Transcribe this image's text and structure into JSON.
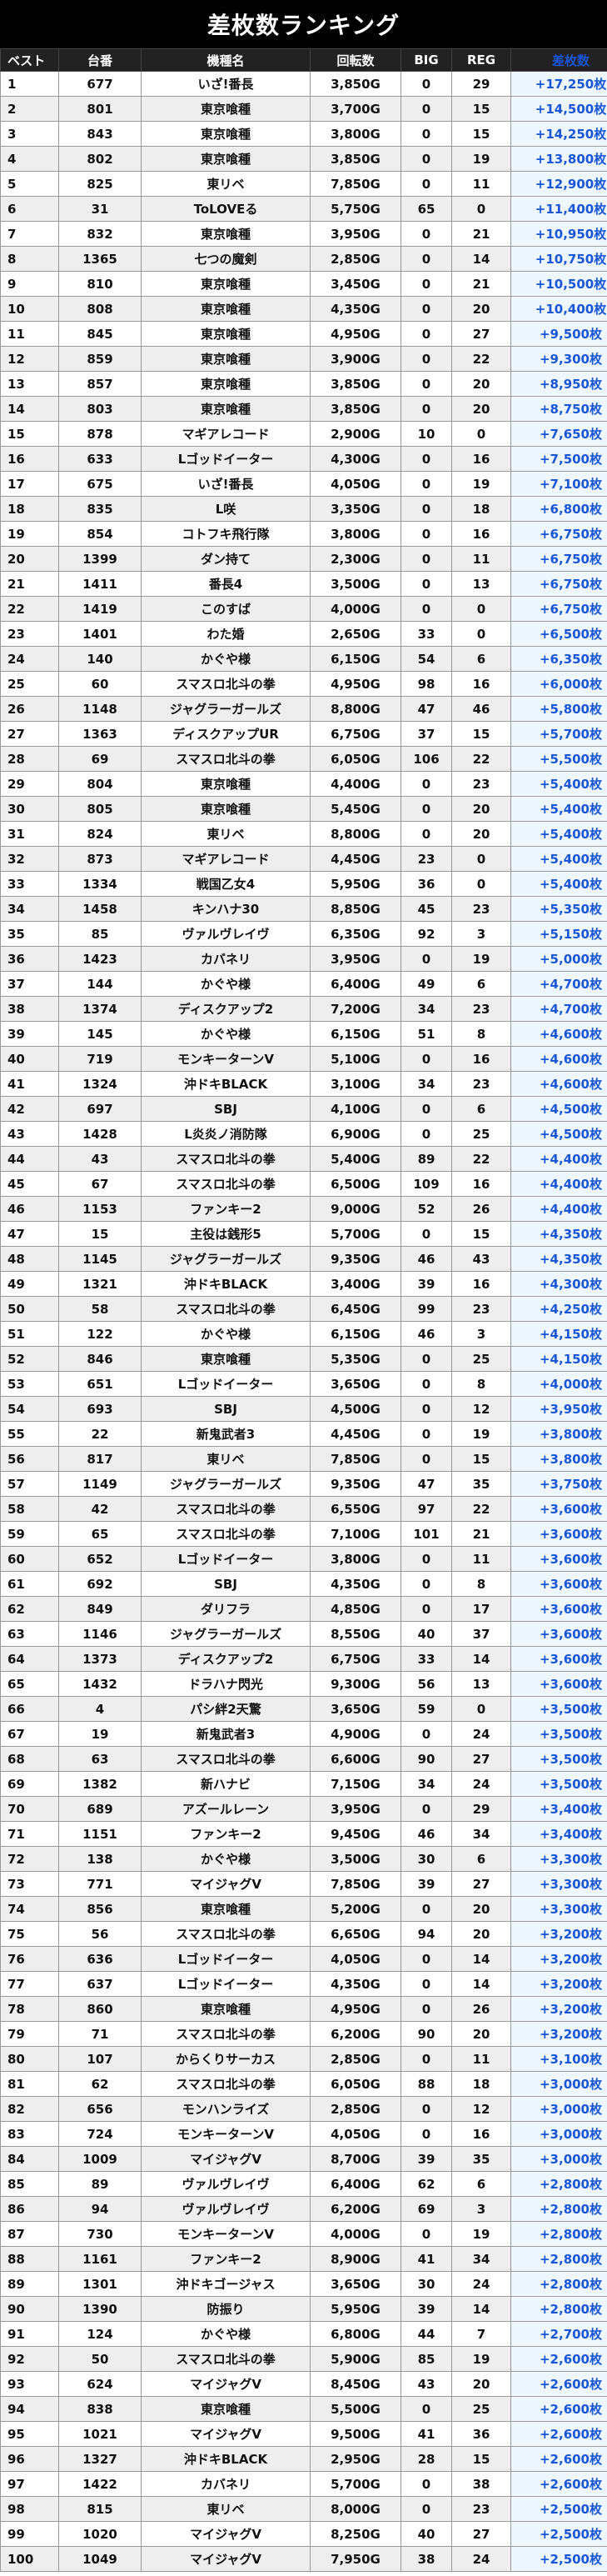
{
  "title": "差枚数ランキング",
  "columns": [
    "ベスト",
    "台番",
    "機種名",
    "回転数",
    "BIG",
    "REG",
    "差枚数"
  ],
  "rows": [
    [
      "1",
      "677",
      "いざ!番長",
      "3,850G",
      "0",
      "29",
      "+17,250枚"
    ],
    [
      "2",
      "801",
      "東京喰種",
      "3,700G",
      "0",
      "15",
      "+14,500枚"
    ],
    [
      "3",
      "843",
      "東京喰種",
      "3,800G",
      "0",
      "15",
      "+14,250枚"
    ],
    [
      "4",
      "802",
      "東京喰種",
      "3,850G",
      "0",
      "19",
      "+13,800枚"
    ],
    [
      "5",
      "825",
      "東リベ",
      "7,850G",
      "0",
      "11",
      "+12,900枚"
    ],
    [
      "6",
      "31",
      "ToLOVEる",
      "5,750G",
      "65",
      "0",
      "+11,400枚"
    ],
    [
      "7",
      "832",
      "東京喰種",
      "3,950G",
      "0",
      "21",
      "+10,950枚"
    ],
    [
      "8",
      "1365",
      "七つの魔剣",
      "2,850G",
      "0",
      "14",
      "+10,750枚"
    ],
    [
      "9",
      "810",
      "東京喰種",
      "3,450G",
      "0",
      "21",
      "+10,500枚"
    ],
    [
      "10",
      "808",
      "東京喰種",
      "4,350G",
      "0",
      "20",
      "+10,400枚"
    ],
    [
      "11",
      "845",
      "東京喰種",
      "4,950G",
      "0",
      "27",
      "+9,500枚"
    ],
    [
      "12",
      "859",
      "東京喰種",
      "3,900G",
      "0",
      "22",
      "+9,300枚"
    ],
    [
      "13",
      "857",
      "東京喰種",
      "3,850G",
      "0",
      "20",
      "+8,950枚"
    ],
    [
      "14",
      "803",
      "東京喰種",
      "3,850G",
      "0",
      "20",
      "+8,750枚"
    ],
    [
      "15",
      "878",
      "マギアレコード",
      "2,900G",
      "10",
      "0",
      "+7,650枚"
    ],
    [
      "16",
      "633",
      "Lゴッドイーター",
      "4,300G",
      "0",
      "16",
      "+7,500枚"
    ],
    [
      "17",
      "675",
      "いざ!番長",
      "4,050G",
      "0",
      "19",
      "+7,100枚"
    ],
    [
      "18",
      "835",
      "L咲",
      "3,350G",
      "0",
      "18",
      "+6,800枚"
    ],
    [
      "19",
      "854",
      "コトフキ飛行隊",
      "3,800G",
      "0",
      "16",
      "+6,750枚"
    ],
    [
      "20",
      "1399",
      "ダン持て",
      "2,300G",
      "0",
      "11",
      "+6,750枚"
    ],
    [
      "21",
      "1411",
      "番長4",
      "3,500G",
      "0",
      "13",
      "+6,750枚"
    ],
    [
      "22",
      "1419",
      "このすば",
      "4,000G",
      "0",
      "0",
      "+6,750枚"
    ],
    [
      "23",
      "1401",
      "わた婚",
      "2,650G",
      "33",
      "0",
      "+6,500枚"
    ],
    [
      "24",
      "140",
      "かぐや様",
      "6,150G",
      "54",
      "6",
      "+6,350枚"
    ],
    [
      "25",
      "60",
      "スマスロ北斗の拳",
      "4,950G",
      "98",
      "16",
      "+6,000枚"
    ],
    [
      "26",
      "1148",
      "ジャグラーガールズ",
      "8,800G",
      "47",
      "46",
      "+5,800枚"
    ],
    [
      "27",
      "1363",
      "ディスクアップUR",
      "6,750G",
      "37",
      "15",
      "+5,700枚"
    ],
    [
      "28",
      "69",
      "スマスロ北斗の拳",
      "6,050G",
      "106",
      "22",
      "+5,500枚"
    ],
    [
      "29",
      "804",
      "東京喰種",
      "4,400G",
      "0",
      "23",
      "+5,400枚"
    ],
    [
      "30",
      "805",
      "東京喰種",
      "5,450G",
      "0",
      "20",
      "+5,400枚"
    ],
    [
      "31",
      "824",
      "東リベ",
      "8,800G",
      "0",
      "20",
      "+5,400枚"
    ],
    [
      "32",
      "873",
      "マギアレコード",
      "4,450G",
      "23",
      "0",
      "+5,400枚"
    ],
    [
      "33",
      "1334",
      "戦国乙女4",
      "5,950G",
      "36",
      "0",
      "+5,400枚"
    ],
    [
      "34",
      "1458",
      "キンハナ30",
      "8,850G",
      "45",
      "23",
      "+5,350枚"
    ],
    [
      "35",
      "85",
      "ヴァルヴレイヴ",
      "6,350G",
      "92",
      "3",
      "+5,150枚"
    ],
    [
      "36",
      "1423",
      "カバネリ",
      "3,950G",
      "0",
      "19",
      "+5,000枚"
    ],
    [
      "37",
      "144",
      "かぐや様",
      "6,400G",
      "49",
      "6",
      "+4,700枚"
    ],
    [
      "38",
      "1374",
      "ディスクアップ2",
      "7,200G",
      "34",
      "23",
      "+4,700枚"
    ],
    [
      "39",
      "145",
      "かぐや様",
      "6,150G",
      "51",
      "8",
      "+4,600枚"
    ],
    [
      "40",
      "719",
      "モンキーターンV",
      "5,100G",
      "0",
      "16",
      "+4,600枚"
    ],
    [
      "41",
      "1324",
      "沖ドキBLACK",
      "3,100G",
      "34",
      "23",
      "+4,600枚"
    ],
    [
      "42",
      "697",
      "SBJ",
      "4,100G",
      "0",
      "6",
      "+4,500枚"
    ],
    [
      "43",
      "1428",
      "L炎炎ノ消防隊",
      "6,900G",
      "0",
      "25",
      "+4,500枚"
    ],
    [
      "44",
      "43",
      "スマスロ北斗の拳",
      "5,400G",
      "89",
      "22",
      "+4,400枚"
    ],
    [
      "45",
      "67",
      "スマスロ北斗の拳",
      "6,500G",
      "109",
      "16",
      "+4,400枚"
    ],
    [
      "46",
      "1153",
      "ファンキー2",
      "9,000G",
      "52",
      "26",
      "+4,400枚"
    ],
    [
      "47",
      "15",
      "主役は銭形5",
      "5,700G",
      "0",
      "15",
      "+4,350枚"
    ],
    [
      "48",
      "1145",
      "ジャグラーガールズ",
      "9,350G",
      "46",
      "43",
      "+4,350枚"
    ],
    [
      "49",
      "1321",
      "沖ドキBLACK",
      "3,400G",
      "39",
      "16",
      "+4,300枚"
    ],
    [
      "50",
      "58",
      "スマスロ北斗の拳",
      "6,450G",
      "99",
      "23",
      "+4,250枚"
    ],
    [
      "51",
      "122",
      "かぐや様",
      "6,150G",
      "46",
      "3",
      "+4,150枚"
    ],
    [
      "52",
      "846",
      "東京喰種",
      "5,350G",
      "0",
      "25",
      "+4,150枚"
    ],
    [
      "53",
      "651",
      "Lゴッドイーター",
      "3,650G",
      "0",
      "8",
      "+4,000枚"
    ],
    [
      "54",
      "693",
      "SBJ",
      "4,500G",
      "0",
      "12",
      "+3,950枚"
    ],
    [
      "55",
      "22",
      "新鬼武者3",
      "4,450G",
      "0",
      "19",
      "+3,800枚"
    ],
    [
      "56",
      "817",
      "東リベ",
      "7,850G",
      "0",
      "15",
      "+3,800枚"
    ],
    [
      "57",
      "1149",
      "ジャグラーガールズ",
      "9,350G",
      "47",
      "35",
      "+3,750枚"
    ],
    [
      "58",
      "42",
      "スマスロ北斗の拳",
      "6,550G",
      "97",
      "22",
      "+3,600枚"
    ],
    [
      "59",
      "65",
      "スマスロ北斗の拳",
      "7,100G",
      "101",
      "21",
      "+3,600枚"
    ],
    [
      "60",
      "652",
      "Lゴッドイーター",
      "3,800G",
      "0",
      "11",
      "+3,600枚"
    ],
    [
      "61",
      "692",
      "SBJ",
      "4,350G",
      "0",
      "8",
      "+3,600枚"
    ],
    [
      "62",
      "849",
      "ダリフラ",
      "4,850G",
      "0",
      "17",
      "+3,600枚"
    ],
    [
      "63",
      "1146",
      "ジャグラーガールズ",
      "8,550G",
      "40",
      "37",
      "+3,600枚"
    ],
    [
      "64",
      "1373",
      "ディスクアップ2",
      "6,750G",
      "33",
      "14",
      "+3,600枚"
    ],
    [
      "65",
      "1432",
      "ドラハナ閃光",
      "9,300G",
      "56",
      "13",
      "+3,600枚"
    ],
    [
      "66",
      "4",
      "パシ絆2天驚",
      "3,650G",
      "59",
      "0",
      "+3,500枚"
    ],
    [
      "67",
      "19",
      "新鬼武者3",
      "4,900G",
      "0",
      "24",
      "+3,500枚"
    ],
    [
      "68",
      "63",
      "スマスロ北斗の拳",
      "6,600G",
      "90",
      "27",
      "+3,500枚"
    ],
    [
      "69",
      "1382",
      "新ハナビ",
      "7,150G",
      "34",
      "24",
      "+3,500枚"
    ],
    [
      "70",
      "689",
      "アズールレーン",
      "3,950G",
      "0",
      "29",
      "+3,400枚"
    ],
    [
      "71",
      "1151",
      "ファンキー2",
      "9,450G",
      "46",
      "34",
      "+3,400枚"
    ],
    [
      "72",
      "138",
      "かぐや様",
      "3,500G",
      "30",
      "6",
      "+3,300枚"
    ],
    [
      "73",
      "771",
      "マイジャグV",
      "7,850G",
      "39",
      "27",
      "+3,300枚"
    ],
    [
      "74",
      "856",
      "東京喰種",
      "5,200G",
      "0",
      "20",
      "+3,300枚"
    ],
    [
      "75",
      "56",
      "スマスロ北斗の拳",
      "6,650G",
      "94",
      "20",
      "+3,200枚"
    ],
    [
      "76",
      "636",
      "Lゴッドイーター",
      "4,050G",
      "0",
      "14",
      "+3,200枚"
    ],
    [
      "77",
      "637",
      "Lゴッドイーター",
      "4,350G",
      "0",
      "14",
      "+3,200枚"
    ],
    [
      "78",
      "860",
      "東京喰種",
      "4,950G",
      "0",
      "26",
      "+3,200枚"
    ],
    [
      "79",
      "71",
      "スマスロ北斗の拳",
      "6,200G",
      "90",
      "20",
      "+3,200枚"
    ],
    [
      "80",
      "107",
      "からくりサーカス",
      "2,850G",
      "0",
      "11",
      "+3,100枚"
    ],
    [
      "81",
      "62",
      "スマスロ北斗の拳",
      "6,050G",
      "88",
      "18",
      "+3,000枚"
    ],
    [
      "82",
      "656",
      "モンハンライズ",
      "2,850G",
      "0",
      "12",
      "+3,000枚"
    ],
    [
      "83",
      "724",
      "モンキーターンV",
      "4,050G",
      "0",
      "16",
      "+3,000枚"
    ],
    [
      "84",
      "1009",
      "マイジャグV",
      "8,700G",
      "39",
      "35",
      "+3,000枚"
    ],
    [
      "85",
      "89",
      "ヴァルヴレイヴ",
      "6,400G",
      "62",
      "6",
      "+2,800枚"
    ],
    [
      "86",
      "94",
      "ヴァルヴレイヴ",
      "6,200G",
      "69",
      "3",
      "+2,800枚"
    ],
    [
      "87",
      "730",
      "モンキーターンV",
      "4,000G",
      "0",
      "19",
      "+2,800枚"
    ],
    [
      "88",
      "1161",
      "ファンキー2",
      "8,900G",
      "41",
      "34",
      "+2,800枚"
    ],
    [
      "89",
      "1301",
      "沖ドキゴージャス",
      "3,650G",
      "30",
      "24",
      "+2,800枚"
    ],
    [
      "90",
      "1390",
      "防振り",
      "5,950G",
      "39",
      "14",
      "+2,800枚"
    ],
    [
      "91",
      "124",
      "かぐや様",
      "6,800G",
      "44",
      "7",
      "+2,700枚"
    ],
    [
      "92",
      "50",
      "スマスロ北斗の拳",
      "5,900G",
      "85",
      "19",
      "+2,600枚"
    ],
    [
      "93",
      "624",
      "マイジャグV",
      "8,450G",
      "43",
      "20",
      "+2,600枚"
    ],
    [
      "94",
      "838",
      "東京喰種",
      "5,500G",
      "0",
      "25",
      "+2,600枚"
    ],
    [
      "95",
      "1021",
      "マイジャグV",
      "9,500G",
      "41",
      "36",
      "+2,600枚"
    ],
    [
      "96",
      "1327",
      "沖ドキBLACK",
      "2,950G",
      "28",
      "15",
      "+2,600枚"
    ],
    [
      "97",
      "1422",
      "カバネリ",
      "5,700G",
      "0",
      "38",
      "+2,600枚"
    ],
    [
      "98",
      "815",
      "東リベ",
      "8,000G",
      "0",
      "23",
      "+2,500枚"
    ],
    [
      "99",
      "1020",
      "マイジャグV",
      "8,250G",
      "40",
      "27",
      "+2,500枚"
    ],
    [
      "100",
      "1049",
      "マイジャグV",
      "7,950G",
      "38",
      "24",
      "+2,500枚"
    ]
  ]
}
